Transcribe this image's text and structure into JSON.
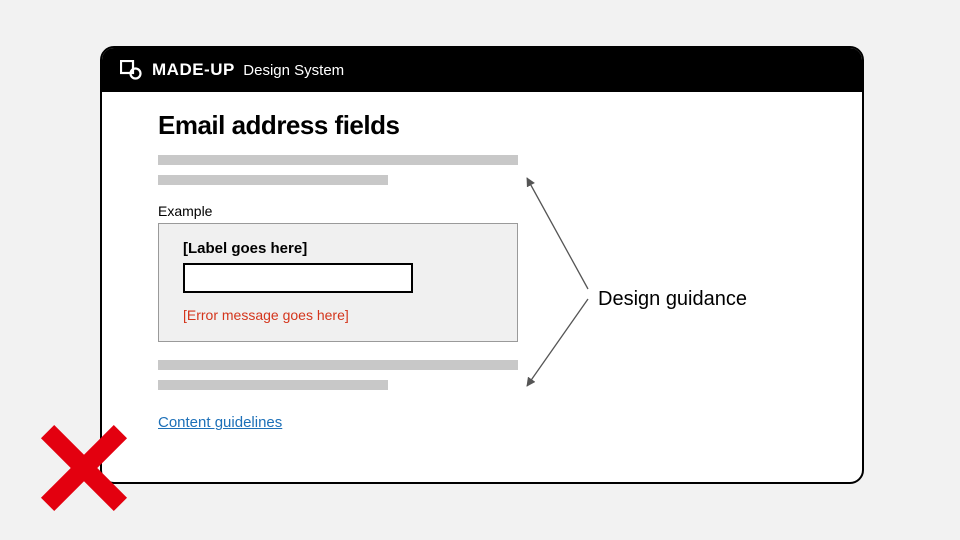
{
  "header": {
    "brand": "MADE-UP",
    "brand_sub": "Design System"
  },
  "page": {
    "title": "Email address fields",
    "example_label": "Example",
    "example": {
      "label_placeholder": "[Label goes here]",
      "error_placeholder": "[Error message goes here]"
    },
    "link_text": "Content guidelines"
  },
  "annotation": {
    "label": "Design guidance"
  }
}
